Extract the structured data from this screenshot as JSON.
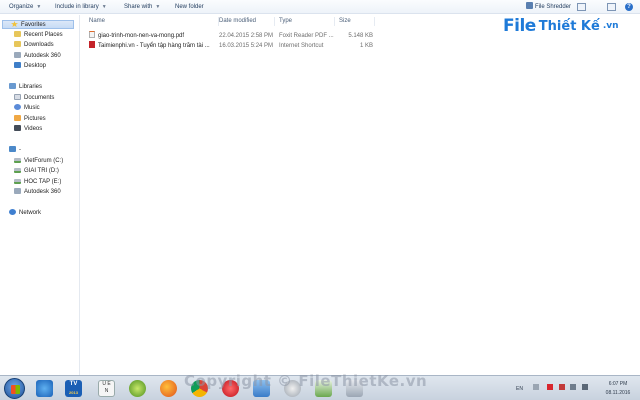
{
  "toolbar": {
    "organize": "Organize",
    "include_in_library": "Include in library",
    "share_with": "Share with",
    "new_folder": "New folder",
    "file_shredder": "File Shredder",
    "help": "?"
  },
  "logo": {
    "file": "File",
    "rest": "Thiết Kế",
    "tld": ".vn"
  },
  "nav": {
    "favorites": "Favorites",
    "recent_places": "Recent Places",
    "downloads": "Downloads",
    "autodesk_fav": "Autodesk 360",
    "desktop": "Desktop",
    "libraries": "Libraries",
    "documents": "Documents",
    "music": "Music",
    "pictures": "Pictures",
    "videos": "Videos",
    "computer": "-",
    "drive_c": "VietForum (C:)",
    "drive_d": "GIAI TRI (D:)",
    "drive_e": "HOC TAP (E:)",
    "autodesk_drive": "Autodesk 360",
    "network": "Network"
  },
  "columns": {
    "name": "Name",
    "date_modified": "Date modified",
    "type": "Type",
    "size": "Size"
  },
  "files": [
    {
      "name": "giao-trinh-mon-nen-va-mong.pdf",
      "date": "22.04.2015 2:58 PM",
      "type": "Foxit Reader PDF ...",
      "size": "5.148 KB",
      "icon": "pdf-icon"
    },
    {
      "name": "Taimienphi.vn - Tuyển tập hàng trăm tài ...",
      "date": "16.03.2015 5:24 PM",
      "type": "Internet Shortcut",
      "size": "1 KB",
      "icon": "url-shortcut-icon"
    }
  ],
  "watermark": "Copyright © FileThietKe.vn",
  "taskbar": {
    "clock_time": "6:07 PM",
    "clock_date": "08.11.2016",
    "language": "EN",
    "tv_badge": "TV",
    "tv_year": "2013",
    "uen_line1": "U E",
    "uen_line2": "N"
  }
}
